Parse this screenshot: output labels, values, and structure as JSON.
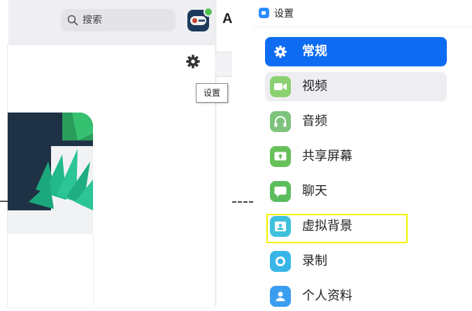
{
  "left_window": {
    "search": {
      "placeholder": "搜索",
      "icon": "search-icon"
    },
    "tooltip": "设置",
    "gear_icon": "gear-icon"
  },
  "middle": {
    "letter": "A"
  },
  "settings": {
    "title": "设置",
    "accent": "#0e6cf2",
    "highlight_color": "#f2f200",
    "nav": [
      {
        "label": "常规",
        "icon": "gear-icon",
        "icon_color": "#0e6cf2",
        "state": "active"
      },
      {
        "label": "视频",
        "icon": "video-camera-icon",
        "icon_color": "#8bd071",
        "state": "hovered"
      },
      {
        "label": "音频",
        "icon": "headphones-icon",
        "icon_color": "#7ec47c",
        "state": "normal"
      },
      {
        "label": "共享屏幕",
        "icon": "share-screen-icon",
        "icon_color": "#68c05b",
        "state": "normal"
      },
      {
        "label": "聊天",
        "icon": "chat-bubble-icon",
        "icon_color": "#5bbd5e",
        "state": "normal"
      },
      {
        "label": "虚拟背景",
        "icon": "virtual-background-icon",
        "icon_color": "#3fc1dc",
        "state": "highlighted"
      },
      {
        "label": "录制",
        "icon": "record-icon",
        "icon_color": "#38b6e8",
        "state": "normal"
      },
      {
        "label": "个人资料",
        "icon": "profile-icon",
        "icon_color": "#3b9df0",
        "state": "normal"
      }
    ]
  }
}
